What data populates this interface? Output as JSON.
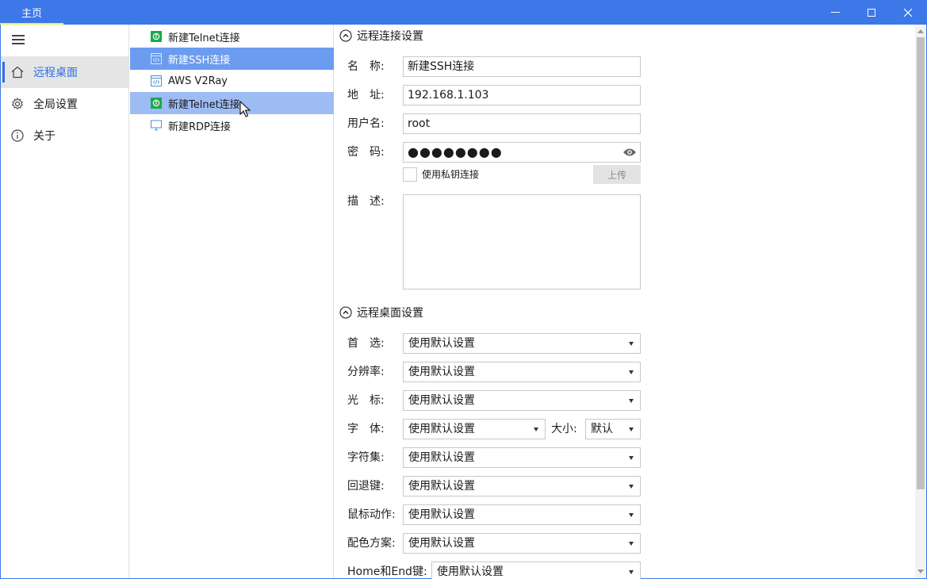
{
  "window": {
    "tab_title": "主页"
  },
  "nav": {
    "items": [
      {
        "label": "远程桌面",
        "icon": "home-icon"
      },
      {
        "label": "全局设置",
        "icon": "gear-icon"
      },
      {
        "label": "关于",
        "icon": "info-icon"
      }
    ]
  },
  "connections": [
    {
      "label": "新建Telnet连接",
      "icon": "telnet-icon"
    },
    {
      "label": "新建SSH连接",
      "icon": "ssh-icon"
    },
    {
      "label": "AWS V2Ray",
      "icon": "ssh-icon"
    },
    {
      "label": "新建Telnet连接",
      "icon": "telnet-icon"
    },
    {
      "label": "新建RDP连接",
      "icon": "monitor-icon"
    }
  ],
  "remote_section": {
    "title": "远程连接设置",
    "name_label": "名　称:",
    "name_value": "新建SSH连接",
    "address_label": "地　址:",
    "address_value": "192.168.1.103",
    "username_label": "用户名:",
    "username_value": "root",
    "password_label": "密　码:",
    "password_value": "●●●●●●●●",
    "private_key_label": "使用私钥连接",
    "upload_label": "上传",
    "description_label": "描　述:"
  },
  "desktop_section": {
    "title": "远程桌面设置",
    "rows": [
      {
        "label": "首　选:",
        "value": "使用默认设置"
      },
      {
        "label": "分辨率:",
        "value": "使用默认设置"
      },
      {
        "label": "光　标:",
        "value": "使用默认设置"
      },
      {
        "label": "字　体:",
        "value": "使用默认设置"
      },
      {
        "label": "字符集:",
        "value": "使用默认设置"
      },
      {
        "label": "回退键:",
        "value": "使用默认设置"
      },
      {
        "label": "鼠标动作:",
        "value": "使用默认设置"
      },
      {
        "label": "配色方案:",
        "value": "使用默认设置"
      },
      {
        "label": "Home和End键:",
        "value": "使用默认设置"
      }
    ],
    "size_label": "大小:",
    "size_value": "默认"
  },
  "colors": {
    "titlebar": "#3c78e8",
    "accent": "#2f6fe0",
    "selected_item": "#6c9cf0",
    "hover_item": "#9ebcf4"
  }
}
